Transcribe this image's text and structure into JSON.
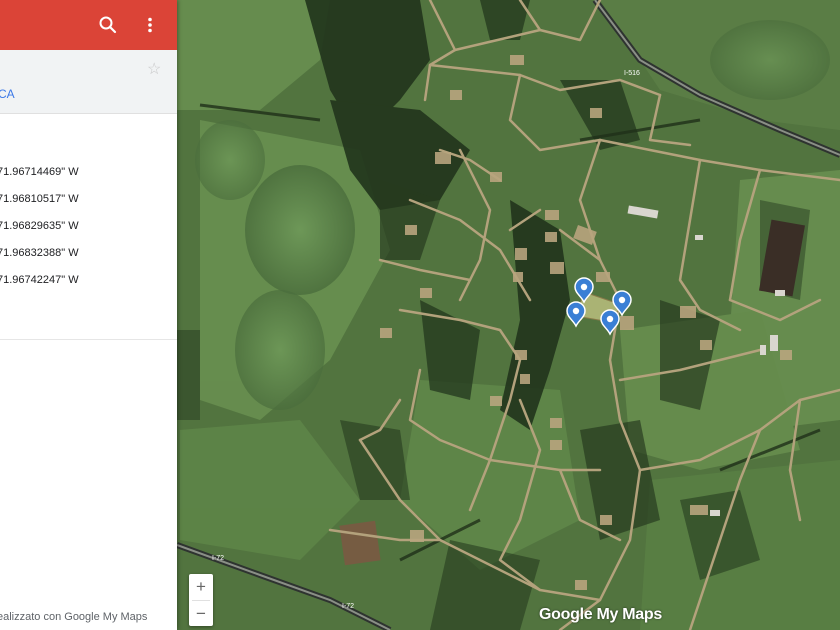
{
  "panel": {
    "layer_name": "CA",
    "coordinates": [
      "71.96714469\" W",
      "71.96810517\" W",
      "71.96829635\" W",
      "71.96832388\" W",
      "71.96742247\" W"
    ],
    "footer": "ealizzato con Google My Maps",
    "header_color": "#db4437",
    "icons": [
      "search-icon",
      "more-vert-icon",
      "star-icon"
    ]
  },
  "map": {
    "road_labels": [
      "I-516",
      "I-72",
      "I-72"
    ],
    "marker_count": 4,
    "marker_color": "#3a7fd5",
    "watermark": "Google My Maps",
    "zoom_in": "+",
    "zoom_out": "−"
  }
}
